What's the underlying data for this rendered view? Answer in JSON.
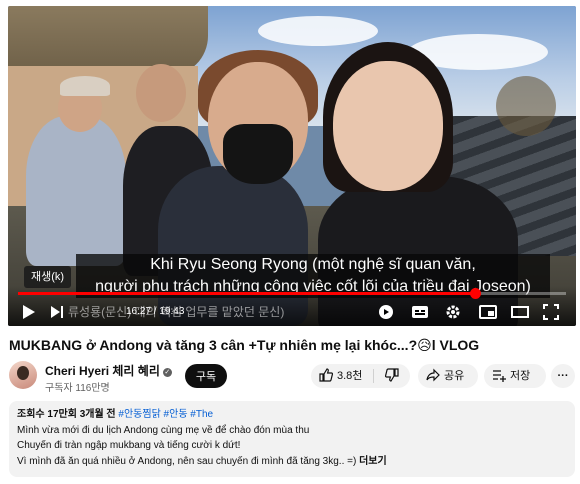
{
  "video": {
    "caption_line1": "Khi Ryu Seong Ryong (một nghệ sĩ quan văn,",
    "caption_line2": "người phụ trách những công việc cốt lõi của triều đại Joseon)",
    "tooltip": "재생(k)",
    "time": "16:27 / 19:43",
    "chapter": "류성룡(문신) 대의 핵심 업무를 맡았던 문신)",
    "progress_fraction": 0.834
  },
  "title": {
    "text": "MUKBANG ở Andong và tăng 3 cân +Tự nhiên mẹ lại khóc...?",
    "emoji": "😥",
    "suffix": "l VLOG"
  },
  "channel": {
    "name": "Cheri Hyeri 체리 혜리",
    "subscribers": "구독자 116만명",
    "subscribe_label": "구독"
  },
  "actions": {
    "like_count": "3.8천",
    "share_label": "공유",
    "save_label": "저장",
    "more_label": "···"
  },
  "description": {
    "views": "조회수 17만회",
    "date": "3개월 전",
    "hashtags": "#안동찜닭 #안동 #The",
    "line1": "Mình vừa mới đi du lịch Andong cùng mẹ về để chào đón mùa thu",
    "line2": "Chuyến đi tràn ngập mukbang và tiếng cười k dứt!",
    "line3": "Vì mình đã ăn quá nhiều ở Andong, nên sau chuyến đi mình đã tăng 3kg.. =)",
    "more_label": "더보기"
  },
  "colors": {
    "progress": "#ff0000",
    "link": "#065fd4",
    "pill_bg": "#f2f2f2"
  }
}
